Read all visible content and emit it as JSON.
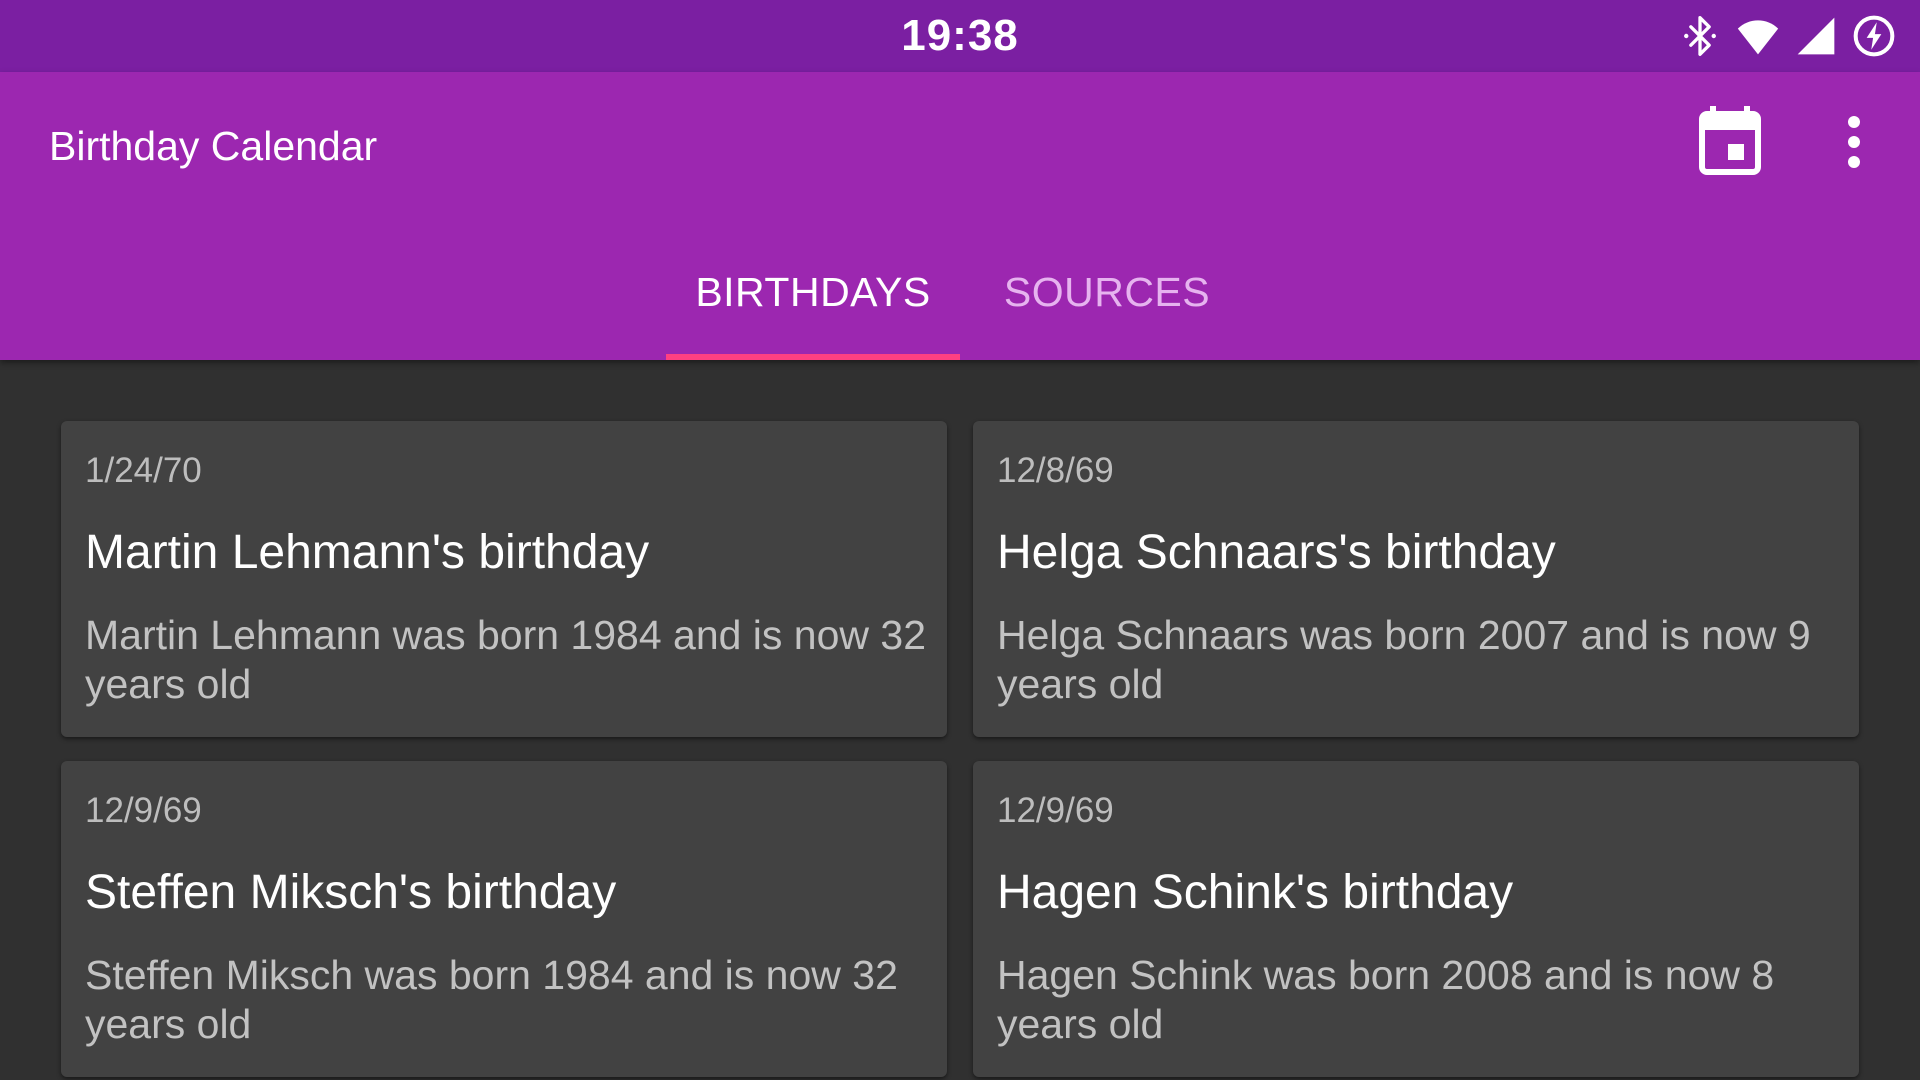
{
  "status_bar": {
    "time": "19:38",
    "icons": [
      "bluetooth-icon",
      "wifi-icon",
      "signal-icon",
      "battery-charging-icon"
    ]
  },
  "app_bar": {
    "title": "Birthday Calendar",
    "actions": [
      "calendar-icon",
      "more-vert-icon"
    ]
  },
  "tabs": [
    {
      "label": "BIRTHDAYS",
      "selected": true
    },
    {
      "label": "SOURCES",
      "selected": false
    }
  ],
  "colors": {
    "status_bar": "#7b1fa2",
    "app_bar": "#9c27b0",
    "tab_indicator": "#ff4081",
    "background": "#303030",
    "card": "#424242"
  },
  "birthdays": [
    {
      "date": "1/24/70",
      "title": "Martin Lehmann's birthday",
      "description": "Martin Lehmann was born 1984 and is now 32 years old"
    },
    {
      "date": "12/8/69",
      "title": "Helga Schnaars's birthday",
      "description": "Helga Schnaars was born 2007 and is now 9 years old"
    },
    {
      "date": "12/9/69",
      "title": "Steffen Miksch's birthday",
      "description": "Steffen Miksch was born 1984 and is now 32 years old"
    },
    {
      "date": "12/9/69",
      "title": "Hagen Schink's birthday",
      "description": "Hagen Schink was born 2008 and is now 8 years old"
    }
  ]
}
